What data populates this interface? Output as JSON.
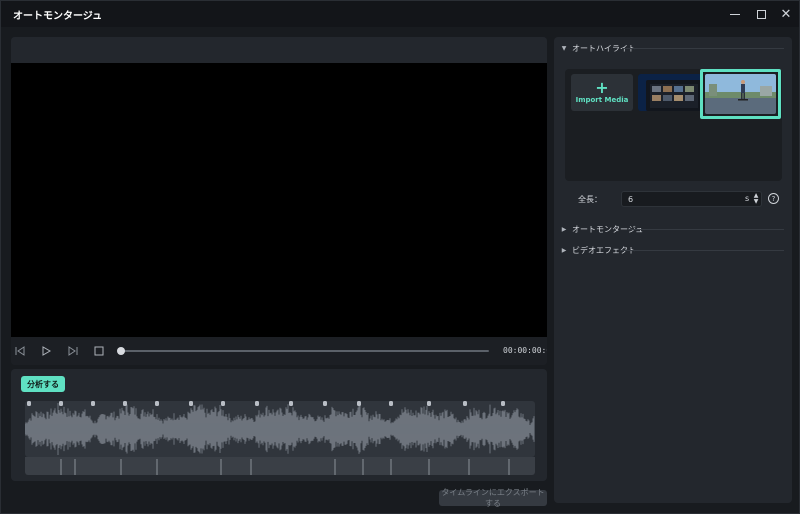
{
  "window": {
    "title": "オートモンタージュ",
    "controls": [
      "minimize",
      "maximize",
      "close"
    ]
  },
  "player": {
    "timecode": "00:00:00:00",
    "progress": 0
  },
  "analysis": {
    "analyze_label": "分析する",
    "export_label": "タイムラインにエクスポートする"
  },
  "right": {
    "section_highlight": "オートハイライト",
    "import_label": "Import Media",
    "import_plus": "+",
    "length_label": "全長：",
    "length_value": "6",
    "length_unit": "s",
    "help": "?",
    "section_montage": "オートモンタージュ",
    "section_effects": "ビデオエフェクト"
  },
  "colors": {
    "accent": "#5fe0c2",
    "background": "#181b1f",
    "panel": "#23272d"
  },
  "icons": {
    "prev": "prev-frame-icon",
    "play": "play-icon",
    "next": "next-frame-icon",
    "stop": "stop-icon",
    "help": "help-circle-icon"
  }
}
